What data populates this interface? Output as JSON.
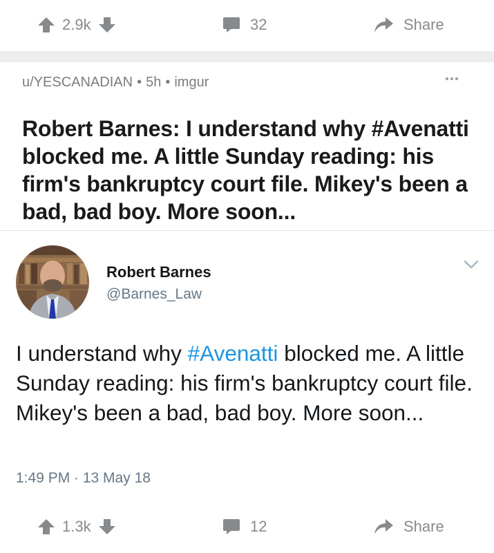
{
  "top_actions": {
    "score": "2.9k",
    "comments": "32",
    "share_label": "Share"
  },
  "post": {
    "author": "u/YESCANADIAN",
    "age": "5h",
    "domain": "imgur",
    "title": "Robert Barnes: I understand why #Avenatti blocked me. A little Sunday reading: his firm's bankruptcy court file. Mikey's been a bad, bad boy. More soon..."
  },
  "tweet": {
    "name": "Robert Barnes",
    "handle": "@Barnes_Law",
    "text_before": "I understand why ",
    "hashtag": "#Avenatti",
    "text_after": " blocked me. A little Sunday reading: his firm's bankruptcy court file. Mikey's been a bad, bad boy. More soon...",
    "timestamp": "1:49 PM · 13 May 18"
  },
  "bottom_actions": {
    "score": "1.3k",
    "comments": "12",
    "share_label": "Share"
  },
  "icons": {
    "upvote": "arrow-up-icon",
    "downvote": "arrow-down-icon",
    "comment": "speech-bubble-icon",
    "share": "share-arrow-icon",
    "more": "ellipsis-icon",
    "chevron": "chevron-down-icon"
  },
  "colors": {
    "icon_gray": "#878a8c",
    "hashtag_blue": "#1b95e0",
    "divider": "#ededed"
  }
}
